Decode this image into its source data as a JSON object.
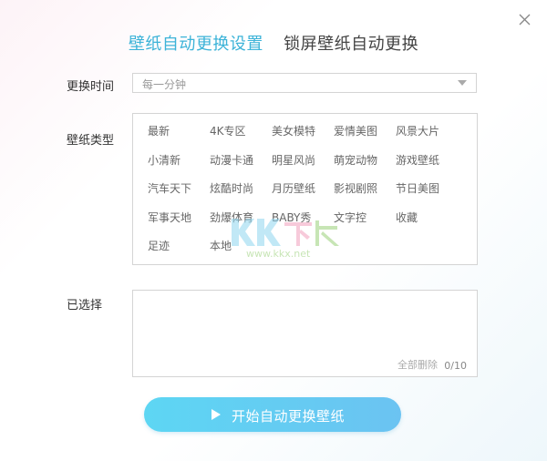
{
  "tabs": [
    {
      "label": "壁纸自动更换设置",
      "active": true
    },
    {
      "label": "锁屏壁纸自动更换",
      "active": false
    }
  ],
  "interval": {
    "label": "更换时间",
    "value": "每一分钟"
  },
  "types": {
    "label": "壁纸类型",
    "items": [
      "最新",
      "4K专区",
      "美女模特",
      "爱情美图",
      "风景大片",
      "小清新",
      "动漫卡通",
      "明星风尚",
      "萌宠动物",
      "游戏壁纸",
      "汽车天下",
      "炫酷时尚",
      "月历壁纸",
      "影视剧照",
      "节日美图",
      "军事天地",
      "劲爆体育",
      "BABY秀",
      "文字控",
      "收藏",
      "足迹",
      "本地"
    ]
  },
  "selected": {
    "label": "已选择",
    "clear_all": "全部删除",
    "count": "0/10"
  },
  "start_button": {
    "label": "开始自动更换壁纸"
  },
  "watermark": {
    "text": "www.kkx.net"
  },
  "colors": {
    "accent": "#3cb3d8",
    "button": "#63cdf3"
  }
}
